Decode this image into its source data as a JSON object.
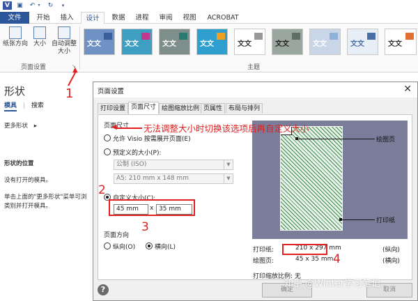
{
  "colors": {
    "accent": "#2b579a",
    "annotation": "#e02020",
    "preview_bg": "#7b7e9a",
    "hatch": "#3a8a4a"
  },
  "titlebar": {
    "icons": [
      "visio-app-icon",
      "save-icon",
      "undo-icon",
      "redo-icon",
      "customize-icon"
    ]
  },
  "tabs": {
    "file": "文件",
    "items": [
      "开始",
      "插入",
      "设计",
      "数据",
      "进程",
      "审阅",
      "视图",
      "ACROBAT"
    ],
    "active": "设计"
  },
  "ribbon": {
    "page_setup": {
      "orientation": "纸张方向",
      "size": "大小",
      "auto_size_1": "自动调整",
      "auto_size_2": "大小",
      "group_label": "页面设置"
    },
    "themes": {
      "group_label": "主题",
      "sample_text": "文文"
    }
  },
  "left_panel": {
    "title": "形状",
    "tab_stencils": "模具",
    "tab_search": "搜索",
    "more_shapes": "更多形状",
    "section": "形状的位置",
    "none_open": "没有打开的模具。",
    "hint_line1": "单击上面的\"更多形状\"菜单可浏",
    "hint_line2": "类别并打开模具。"
  },
  "dialog": {
    "title": "页面设置",
    "tabs": [
      "打印设置",
      "页面尺寸",
      "绘图缩放比例",
      "页属性",
      "布局与排列"
    ],
    "active_tab": "页面尺寸",
    "section_size": "页面尺寸",
    "opt_grow": "允许 Visio 按需展开页面(E)",
    "opt_predefined": "预定义的大小(P):",
    "combo_standard": "公制 (ISO)",
    "combo_paper": "A5: 210 mm x 148 mm",
    "opt_custom": "自定义大小(C):",
    "width": "45 mm",
    "times": "x",
    "height": "35 mm",
    "section_orientation": "页面方向",
    "portrait": "纵向(O)",
    "landscape": "横向(L)",
    "preview": {
      "drawing_page": "绘图页",
      "printer_paper": "打印纸"
    },
    "printer_label": "打印纸:",
    "printer_value": "210 x 297 mm",
    "printer_orient": "(纵向)",
    "drawing_label": "绘图页:",
    "drawing_value": "45 x 35 mm",
    "drawing_orient": "(横向)",
    "scale_label": "打印缩放比例: 无",
    "help": "?",
    "ok": "确定",
    "cancel": "取消"
  },
  "annotations": {
    "n1": "1",
    "n2": "2",
    "n3": "3",
    "n4": "4",
    "note": "无法调整大小时切换该选项后再自定义大小"
  },
  "watermark": "知乎 @Winter学习笔记"
}
